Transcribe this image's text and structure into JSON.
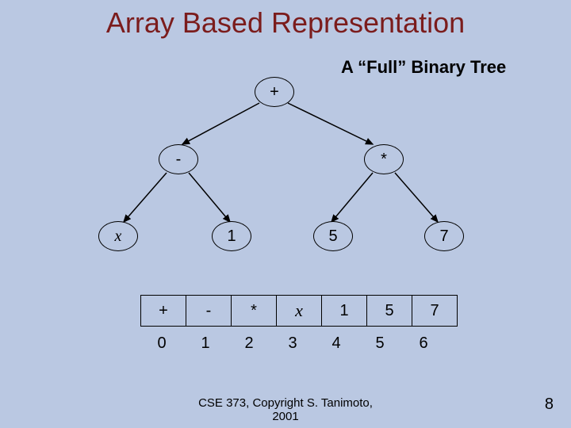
{
  "title": "Array Based Representation",
  "subtitle": "A “Full” Binary Tree",
  "tree": {
    "root": "+",
    "l": "-",
    "r": "*",
    "ll": "x",
    "lr": "1",
    "rl": "5",
    "rr": "7"
  },
  "array": {
    "cells": [
      "+",
      "-",
      "*",
      "x",
      "1",
      "5",
      "7"
    ],
    "indices": [
      "0",
      "1",
      "2",
      "3",
      "4",
      "5",
      "6"
    ]
  },
  "footer": {
    "line1": "CSE 373,  Copyright S. Tanimoto,",
    "line2": "2001"
  },
  "pagenum": "8",
  "chart_data": {
    "type": "tree",
    "description": "Full binary tree of an arithmetic expression and its array (level-order) representation",
    "nodes": [
      {
        "id": 0,
        "label": "+",
        "children": [
          1,
          2
        ]
      },
      {
        "id": 1,
        "label": "-",
        "children": [
          3,
          4
        ]
      },
      {
        "id": 2,
        "label": "*",
        "children": [
          5,
          6
        ]
      },
      {
        "id": 3,
        "label": "x",
        "children": []
      },
      {
        "id": 4,
        "label": "1",
        "children": []
      },
      {
        "id": 5,
        "label": "5",
        "children": []
      },
      {
        "id": 6,
        "label": "7",
        "children": []
      }
    ],
    "array_repr": {
      "index": [
        0,
        1,
        2,
        3,
        4,
        5,
        6
      ],
      "value": [
        "+",
        "-",
        "*",
        "x",
        "1",
        "5",
        "7"
      ]
    }
  }
}
